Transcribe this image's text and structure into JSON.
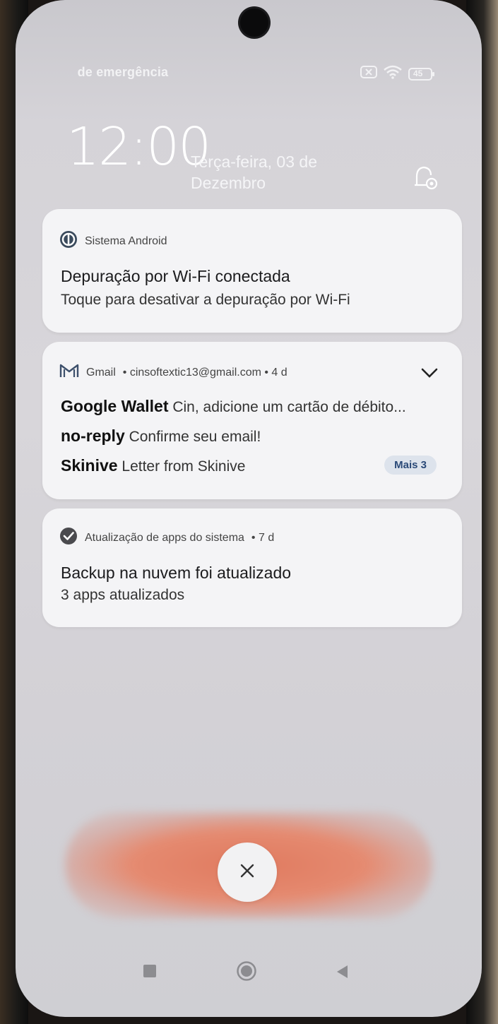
{
  "status_bar": {
    "carrier_prefix": "..",
    "carrier_text": "de emergência",
    "battery": "45",
    "icons": [
      "sim-off-icon",
      "wifi-icon",
      "battery-icon"
    ]
  },
  "lockscreen": {
    "time": "12:00",
    "date": "Terça-feira, 03 de Dezembro"
  },
  "notifications": [
    {
      "app": "Sistema Android",
      "icon": "android-system-icon",
      "title": "Depuração por Wi-Fi conectada",
      "body": "Toque para desativar a depuração por Wi-Fi"
    },
    {
      "app": "Gmail",
      "icon": "gmail-icon",
      "header_rest": "• cinsoftextic13@gmail.com • 4 d",
      "messages": [
        {
          "sender": "Google Wallet",
          "text": "Cin, adicione um cartão de débito..."
        },
        {
          "sender": "no-reply",
          "text": "Confirme seu email!"
        },
        {
          "sender": "Skinive",
          "text": "Letter from Skinive"
        }
      ],
      "more_label": "Mais 3"
    },
    {
      "app": "Atualização de apps do sistema",
      "icon": "check-circle-icon",
      "header_rest": "• 7 d",
      "title": "Backup na nuvem foi atualizado",
      "body": "3 apps atualizados"
    }
  ],
  "colors": {
    "card_bg": "#f4f4f6",
    "badge_bg": "#dde3ec",
    "badge_text": "#2b4a78",
    "accent_blur": "#e07a5f"
  }
}
